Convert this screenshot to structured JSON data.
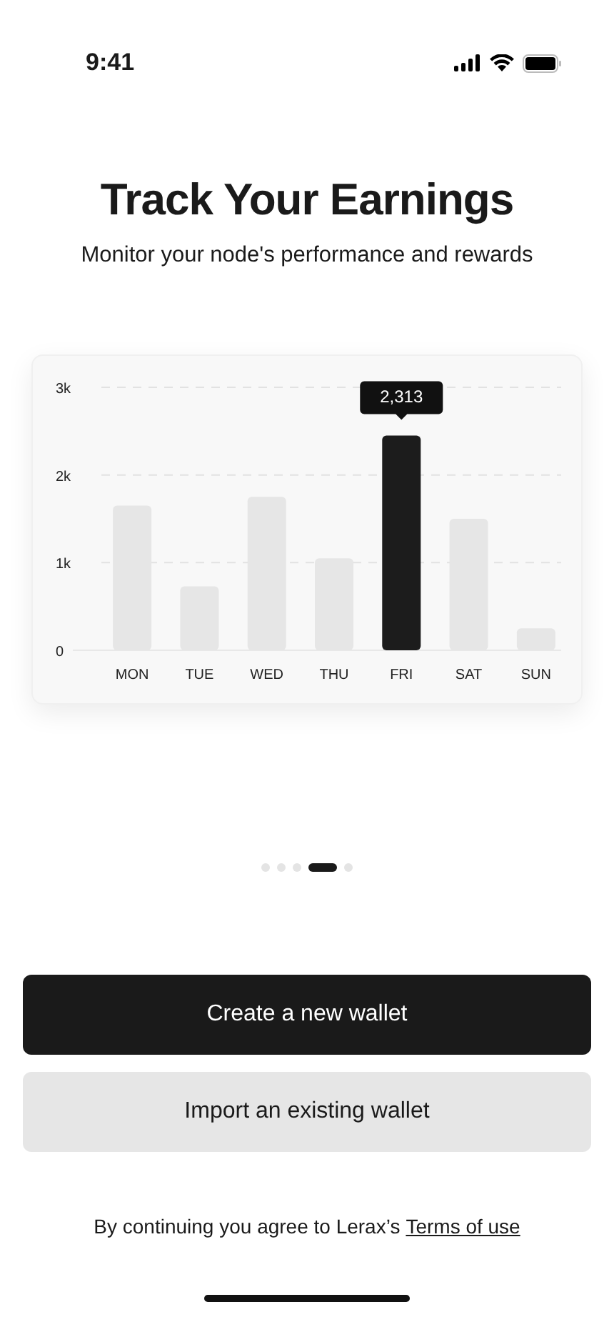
{
  "status_bar": {
    "time": "9:41"
  },
  "title": "Track Your Earnings",
  "subtitle": "Monitor your node's performance and rewards",
  "earnings_card": {
    "chart_data": {
      "type": "bar",
      "categories": [
        "MON",
        "TUE",
        "WED",
        "THU",
        "FRI",
        "SAT",
        "SUN"
      ],
      "series": [
        {
          "color": "#e6e6e6",
          "values": [
            1650,
            730,
            1750,
            1050,
            null,
            1500,
            250
          ]
        },
        {
          "color": "#1c1c1c",
          "values": [
            null,
            null,
            null,
            null,
            2450,
            null,
            null
          ]
        }
      ],
      "stacked": true,
      "ylim": [
        0,
        3000
      ],
      "yticks": [
        {
          "value": 0,
          "label": "0"
        },
        {
          "value": 1000,
          "label": "1k"
        },
        {
          "value": 2000,
          "label": "2k"
        },
        {
          "value": 3000,
          "label": "3k"
        }
      ],
      "annotations": [
        "2,313"
      ]
    }
  },
  "pager": [
    {
      "selected": false
    },
    {
      "selected": false
    },
    {
      "selected": false
    },
    {
      "selected": true
    },
    {
      "selected": false
    }
  ],
  "buttons": [
    {
      "kind": "primary",
      "label": "Create a new wallet"
    },
    {
      "kind": "secondary",
      "label": "Import an existing wallet"
    }
  ],
  "footer": {
    "text": "By continuing you agree to Lerax’s",
    "link": "Terms of use"
  }
}
